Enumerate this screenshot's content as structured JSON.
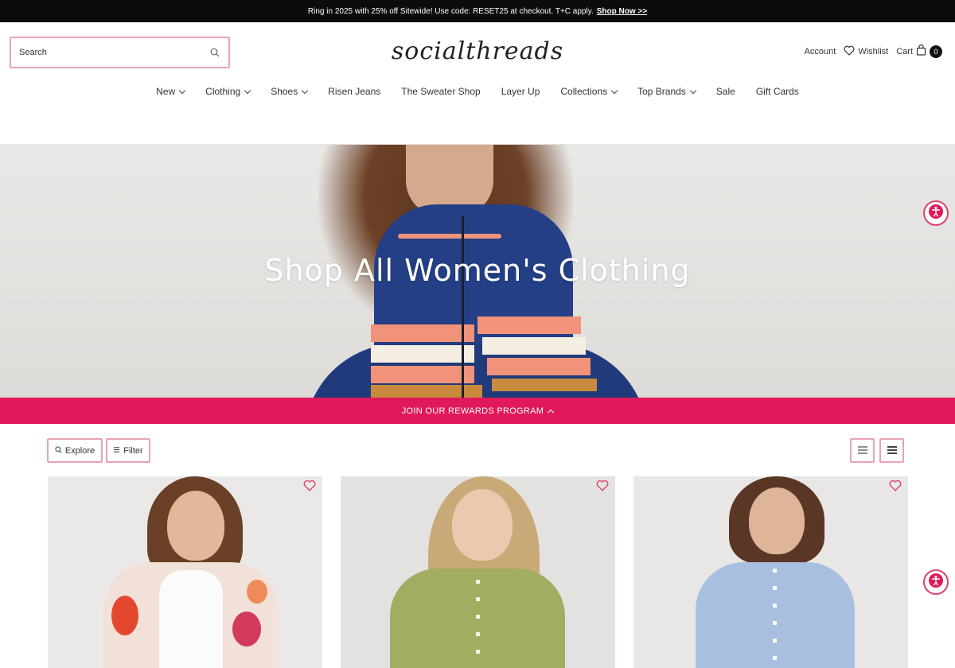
{
  "announcement": {
    "text": "Ring in 2025 with 25% off Sitewide! Use code: RESET25 at checkout. T+C apply.",
    "link": "Shop Now >>"
  },
  "header": {
    "search_placeholder": "Search",
    "logo": "socialthreads",
    "account": "Account",
    "wishlist": "Wishlist",
    "cart": "Cart",
    "cart_count": "0"
  },
  "nav": {
    "items": [
      {
        "label": "New",
        "dropdown": true
      },
      {
        "label": "Clothing",
        "dropdown": true
      },
      {
        "label": "Shoes",
        "dropdown": true
      },
      {
        "label": "Risen Jeans",
        "dropdown": false
      },
      {
        "label": "The Sweater Shop",
        "dropdown": false
      },
      {
        "label": "Layer Up",
        "dropdown": false
      },
      {
        "label": "Collections",
        "dropdown": true
      },
      {
        "label": "Top Brands",
        "dropdown": true
      },
      {
        "label": "Sale",
        "dropdown": false
      },
      {
        "label": "Gift Cards",
        "dropdown": false
      }
    ]
  },
  "hero": {
    "title": "Shop All Women's Clothing"
  },
  "rewards": {
    "label": "JOIN OUR REWARDS PROGRAM"
  },
  "toolbar": {
    "explore": "Explore",
    "filter": "Filter"
  },
  "colors": {
    "accent": "#e0195a",
    "border_pink": "#e9a3b6",
    "announcement_bg": "#0c0c0c"
  },
  "icons": {
    "search": "search-icon",
    "wishlist": "heart-icon",
    "cart": "bag-icon",
    "accessibility": "accessibility-icon",
    "grid_view": "grid-icon",
    "list_view": "list-icon"
  }
}
